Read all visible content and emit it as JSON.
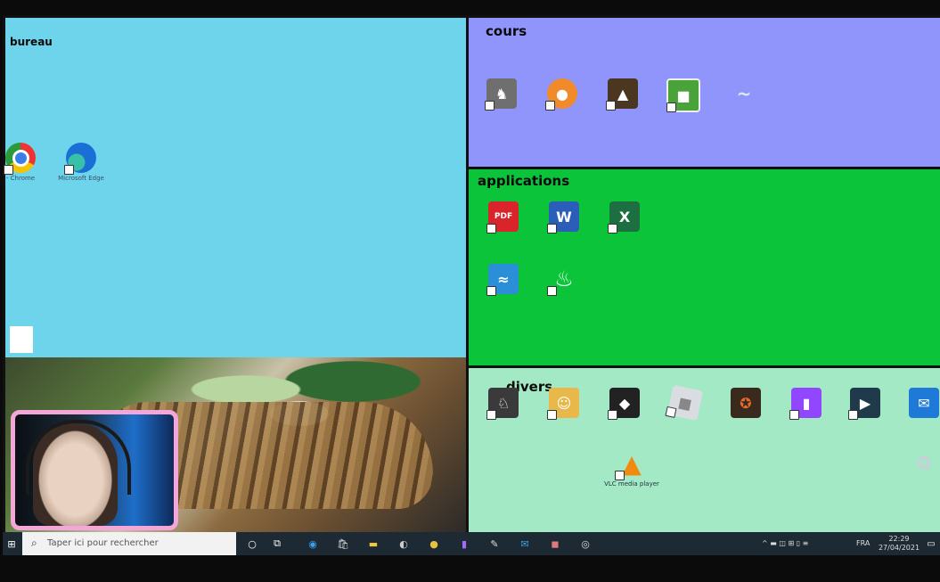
{
  "desktop": {
    "bureau": {
      "title": "bureau",
      "icons": [
        {
          "label": "- Chrome",
          "icon": "chrome-icon"
        },
        {
          "label": "Microsoft Edge",
          "icon": "edge-icon"
        },
        {
          "label": "",
          "icon": "blank-file-icon"
        }
      ]
    },
    "cours": {
      "title": "cours",
      "icons": [
        {
          "label": "",
          "icon": "horse-icon"
        },
        {
          "label": "",
          "icon": "charmander-icon"
        },
        {
          "label": "",
          "icon": "tree-icon"
        },
        {
          "label": "",
          "icon": "minecraft-icon"
        },
        {
          "label": "",
          "icon": "dolphin-icon"
        }
      ]
    },
    "applications": {
      "title": "applications",
      "icons": [
        {
          "label": "",
          "icon": "pdf-icon"
        },
        {
          "label": "",
          "icon": "word-icon"
        },
        {
          "label": "",
          "icon": "excel-icon"
        },
        {
          "label": "",
          "icon": "blue-app-icon"
        },
        {
          "label": "",
          "icon": "flame-app-icon"
        }
      ]
    },
    "divers": {
      "title": "divers",
      "icons": [
        {
          "label": "",
          "icon": "llama-icon"
        },
        {
          "label": "",
          "icon": "user-icon"
        },
        {
          "label": "",
          "icon": "game-icon"
        },
        {
          "label": "",
          "icon": "roblox-icon"
        },
        {
          "label": "",
          "icon": "team-fortress-icon"
        },
        {
          "label": "",
          "icon": "twitch-icon"
        },
        {
          "label": "",
          "icon": "streamlabs-icon"
        },
        {
          "label": "",
          "icon": "mail-icon"
        },
        {
          "label": "VLC media player",
          "icon": "vlc-icon"
        },
        {
          "label": "",
          "icon": "recycle-bin-icon"
        }
      ]
    }
  },
  "taskbar": {
    "search_placeholder": "Taper ici pour rechercher",
    "lang": "FRA",
    "time": "22:29",
    "date": "27/04/2021"
  },
  "colors": {
    "bureau": "#6dd4ec",
    "cours": "#8f95fb",
    "applications": "#0cc43a",
    "divers": "#a3e9c5",
    "taskbar": "#1e2a33"
  }
}
